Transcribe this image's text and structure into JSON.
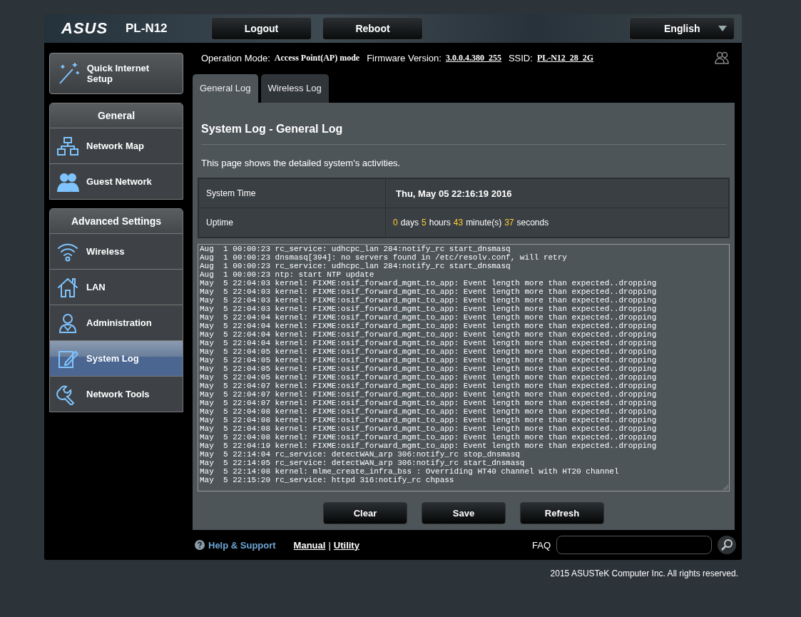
{
  "header": {
    "logo": "ASUS",
    "model": "PL-N12",
    "buttons": [
      "Logout",
      "Reboot"
    ],
    "language": "English"
  },
  "sidebar": {
    "quick_setup": "Quick Internet Setup",
    "sections": [
      {
        "title": "General",
        "items": [
          {
            "label": "Network Map",
            "selected": false
          },
          {
            "label": "Guest Network",
            "selected": false
          }
        ]
      },
      {
        "title": "Advanced Settings",
        "items": [
          {
            "label": "Wireless",
            "selected": false
          },
          {
            "label": "LAN",
            "selected": false
          },
          {
            "label": "Administration",
            "selected": false
          },
          {
            "label": "System Log",
            "selected": true
          },
          {
            "label": "Network Tools",
            "selected": false
          }
        ]
      }
    ]
  },
  "info": {
    "mode_label": "Operation Mode:",
    "mode_value": "Access Point(AP) mode",
    "firmware_label": "Firmware Version:",
    "firmware_value": "3.0.0.4.380_255",
    "ssid_label": "SSID:",
    "ssid_value": "PL-N12_28_2G"
  },
  "tabs": [
    {
      "label": "General Log",
      "selected": true
    },
    {
      "label": "Wireless Log",
      "selected": false
    }
  ],
  "panel": {
    "title": "System Log - General Log",
    "description": "This page shows the detailed system's activities.",
    "rows": [
      {
        "label": "System Time",
        "kind": "text",
        "value": "Thu, May 05 22:16:19 2016"
      },
      {
        "label": "Uptime",
        "kind": "duration",
        "parts": [
          {
            "number": "0",
            "unit": "days"
          },
          {
            "number": "5",
            "unit": "hours"
          },
          {
            "number": "43",
            "unit": "minute(s)"
          },
          {
            "number": "37",
            "unit": "seconds"
          }
        ]
      }
    ],
    "log": [
      "Aug  1 00:00:23 rc_service: udhcpc_lan 284:notify_rc start_dnsmasq",
      "Aug  1 00:00:23 dnsmasq[394]: no servers found in /etc/resolv.conf, will retry",
      "Aug  1 00:00:23 rc_service: udhcpc_lan 284:notify_rc start_dnsmasq",
      "Aug  1 00:00:23 ntp: start NTP update",
      "May  5 22:04:03 kernel: FIXME:osif_forward_mgmt_to_app: Event length more than expected..dropping",
      "May  5 22:04:03 kernel: FIXME:osif_forward_mgmt_to_app: Event length more than expected..dropping",
      "May  5 22:04:03 kernel: FIXME:osif_forward_mgmt_to_app: Event length more than expected..dropping",
      "May  5 22:04:03 kernel: FIXME:osif_forward_mgmt_to_app: Event length more than expected..dropping",
      "May  5 22:04:04 kernel: FIXME:osif_forward_mgmt_to_app: Event length more than expected..dropping",
      "May  5 22:04:04 kernel: FIXME:osif_forward_mgmt_to_app: Event length more than expected..dropping",
      "May  5 22:04:04 kernel: FIXME:osif_forward_mgmt_to_app: Event length more than expected..dropping",
      "May  5 22:04:04 kernel: FIXME:osif_forward_mgmt_to_app: Event length more than expected..dropping",
      "May  5 22:04:05 kernel: FIXME:osif_forward_mgmt_to_app: Event length more than expected..dropping",
      "May  5 22:04:05 kernel: FIXME:osif_forward_mgmt_to_app: Event length more than expected..dropping",
      "May  5 22:04:05 kernel: FIXME:osif_forward_mgmt_to_app: Event length more than expected..dropping",
      "May  5 22:04:05 kernel: FIXME:osif_forward_mgmt_to_app: Event length more than expected..dropping",
      "May  5 22:04:07 kernel: FIXME:osif_forward_mgmt_to_app: Event length more than expected..dropping",
      "May  5 22:04:07 kernel: FIXME:osif_forward_mgmt_to_app: Event length more than expected..dropping",
      "May  5 22:04:07 kernel: FIXME:osif_forward_mgmt_to_app: Event length more than expected..dropping",
      "May  5 22:04:08 kernel: FIXME:osif_forward_mgmt_to_app: Event length more than expected..dropping",
      "May  5 22:04:08 kernel: FIXME:osif_forward_mgmt_to_app: Event length more than expected..dropping",
      "May  5 22:04:08 kernel: FIXME:osif_forward_mgmt_to_app: Event length more than expected..dropping",
      "May  5 22:04:08 kernel: FIXME:osif_forward_mgmt_to_app: Event length more than expected..dropping",
      "May  5 22:04:19 kernel: FIXME:osif_forward_mgmt_to_app: Event length more than expected..dropping",
      "May  5 22:14:04 rc_service: detectWAN_arp 306:notify_rc stop_dnsmasq",
      "May  5 22:14:05 rc_service: detectWAN_arp 306:notify_rc start_dnsmasq",
      "May  5 22:14:08 kernel: mlme_create_infra_bss : Overriding HT40 channel with HT20 channel",
      "May  5 22:15:20 rc_service: httpd 316:notify_rc chpass"
    ],
    "buttons": [
      "Clear",
      "Save",
      "Refresh"
    ]
  },
  "footer": {
    "help": "Help & Support",
    "links": [
      "Manual",
      "Utility"
    ],
    "separator": "|",
    "faq": "FAQ",
    "copyright": "2015 ASUSTeK Computer Inc. All rights reserved."
  }
}
